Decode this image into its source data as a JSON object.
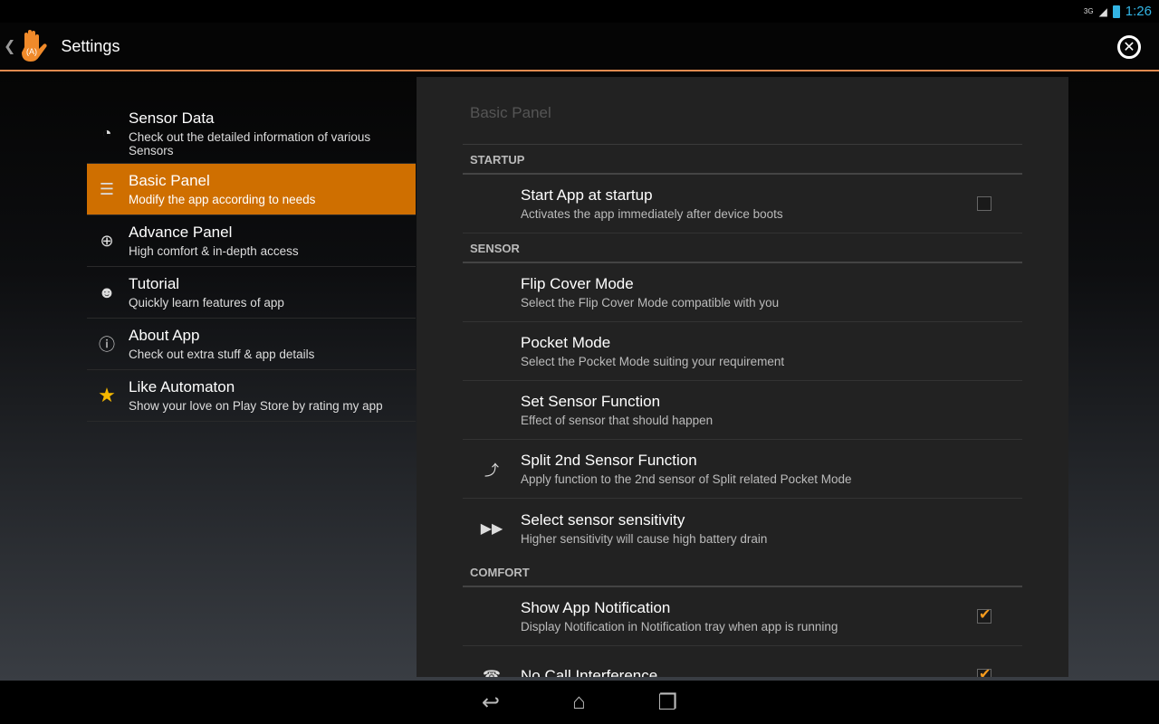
{
  "status": {
    "network": "3G",
    "time": "1:26"
  },
  "actionbar": {
    "title": "Settings",
    "logo_text": "(A)"
  },
  "sidebar": {
    "items": [
      {
        "title": "Sensor Data",
        "subtitle": "Check out the detailed information of various Sensors",
        "icon": "gauge-icon",
        "selected": false
      },
      {
        "title": "Basic Panel",
        "subtitle": "Modify the app according to needs",
        "icon": "list-icon",
        "selected": true
      },
      {
        "title": "Advance Panel",
        "subtitle": "High comfort & in-depth access",
        "icon": "plus-circle-icon",
        "selected": false
      },
      {
        "title": "Tutorial",
        "subtitle": "Quickly learn features of app",
        "icon": "person-icon",
        "selected": false
      },
      {
        "title": "About App",
        "subtitle": "Check out extra stuff & app details",
        "icon": "info-icon",
        "selected": false
      },
      {
        "title": "Like Automaton",
        "subtitle": "Show your love on Play Store by rating my app",
        "icon": "star-icon",
        "selected": false
      }
    ]
  },
  "panel": {
    "title": "Basic Panel",
    "startup": {
      "header": "STARTUP",
      "items": [
        {
          "title": "Start App at startup",
          "subtitle": "Activates the app immediately after device boots",
          "checked": false
        }
      ]
    },
    "sensor": {
      "header": "SENSOR",
      "items": [
        {
          "title": "Flip Cover Mode",
          "subtitle": "Select the Flip Cover Mode compatible with you"
        },
        {
          "title": "Pocket Mode",
          "subtitle": "Select the Pocket Mode suiting your requirement"
        },
        {
          "title": "Set Sensor Function",
          "subtitle": "Effect of sensor that should happen"
        },
        {
          "title": "Split 2nd Sensor Function",
          "subtitle": "Apply function to the 2nd sensor of Split related Pocket Mode",
          "icon": "split-arrow-icon"
        },
        {
          "title": "Select sensor sensitivity",
          "subtitle": "Higher sensitivity will cause high battery drain",
          "icon": "fast-forward-icon"
        }
      ]
    },
    "comfort": {
      "header": "COMFORT",
      "items": [
        {
          "title": "Show App Notification",
          "subtitle": "Display Notification in Notification tray when app is running",
          "checked": true
        },
        {
          "title": "No Call Interference",
          "checked": true,
          "icon": "phone-icon"
        }
      ]
    }
  },
  "colors": {
    "accent": "#cf6f00",
    "status": "#33b5e5",
    "check": "#f39a1e"
  }
}
